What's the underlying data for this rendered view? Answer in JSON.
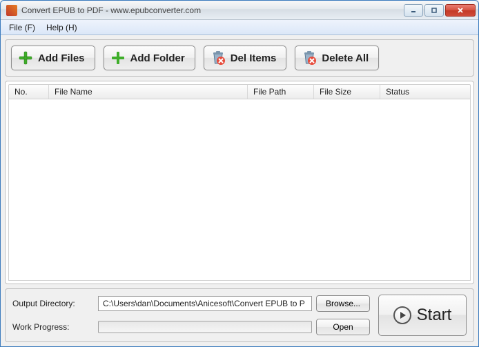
{
  "window": {
    "title": "Convert EPUB to PDF - www.epubconverter.com"
  },
  "menu": {
    "file": "File (F)",
    "help": "Help (H)"
  },
  "toolbar": {
    "add_files": "Add Files",
    "add_folder": "Add Folder",
    "del_items": "Del Items",
    "delete_all": "Delete All"
  },
  "columns": {
    "no": "No.",
    "file_name": "File Name",
    "file_path": "File Path",
    "file_size": "File Size",
    "status": "Status"
  },
  "rows": [],
  "bottom": {
    "output_label": "Output Directory:",
    "output_value": "C:\\Users\\dan\\Documents\\Anicesoft\\Convert EPUB to P",
    "browse": "Browse...",
    "progress_label": "Work Progress:",
    "open": "Open",
    "start": "Start"
  }
}
